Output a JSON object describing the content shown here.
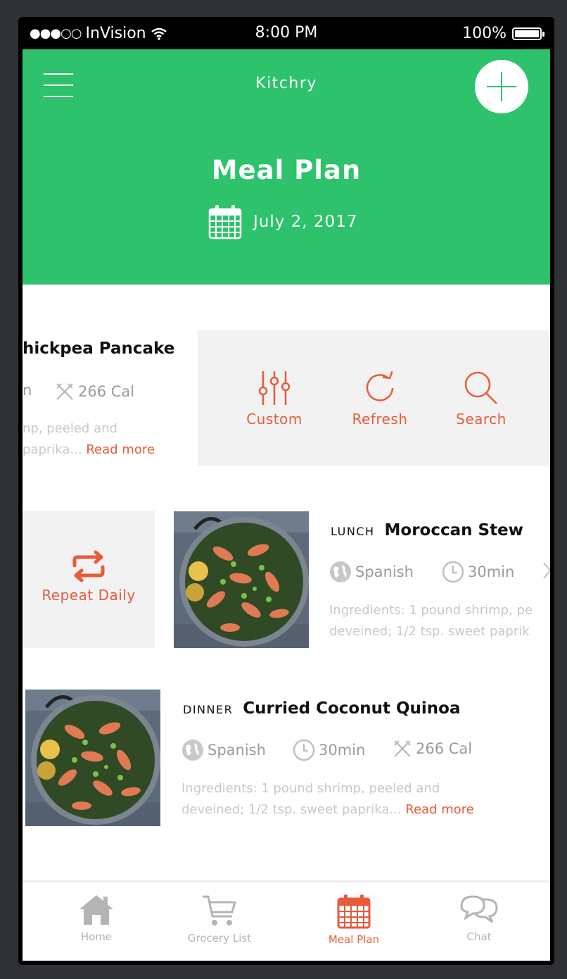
{
  "status_bar": {
    "carrier": "InVision",
    "time": "8:00 PM",
    "battery": "100%"
  },
  "header": {
    "app_title": "Kitchry",
    "page_title": "Meal Plan",
    "date": "July 2, 2017"
  },
  "meals": [
    {
      "type": "",
      "name": "hickpea Pancake",
      "cuisine": "",
      "time_fragment": "n",
      "calories": "266 Cal",
      "ingredients_line1": "np, peeled and",
      "ingredients_line2": "paprika...",
      "read_more": "Read more",
      "actions": [
        {
          "label": "Custom",
          "icon": "sliders-icon"
        },
        {
          "label": "Refresh",
          "icon": "refresh-icon"
        },
        {
          "label": "Search",
          "icon": "search-icon"
        }
      ]
    },
    {
      "type": "LUNCH",
      "name": "Moroccan Stew",
      "cuisine": "Spanish",
      "time": "30min",
      "ingredients_line1": "Ingredients: 1 pound shrimp, pe",
      "ingredients_line2": "deveined; 1/2 tsp. sweet paprik",
      "action": {
        "label": "Repeat Daily",
        "icon": "repeat-icon"
      }
    },
    {
      "type": "DINNER",
      "name": "Curried Coconut Quinoa",
      "cuisine": "Spanish",
      "time": "30min",
      "calories": "266 Cal",
      "ingredients_line1": "Ingredients: 1 pound shrimp, peeled and",
      "ingredients_line2": "deveined; 1/2 tsp. sweet paprika...",
      "read_more": "Read more"
    }
  ],
  "tabs": [
    {
      "label": "Home",
      "icon": "home-icon",
      "active": false
    },
    {
      "label": "Grocery List",
      "icon": "cart-icon",
      "active": false
    },
    {
      "label": "Meal Plan",
      "icon": "calendar-icon",
      "active": true
    },
    {
      "label": "Chat",
      "icon": "chat-icon",
      "active": false
    }
  ],
  "colors": {
    "brand_green": "#2dc26b",
    "accent_orange": "#e85b3a",
    "muted_text": "#9b9b9b"
  }
}
